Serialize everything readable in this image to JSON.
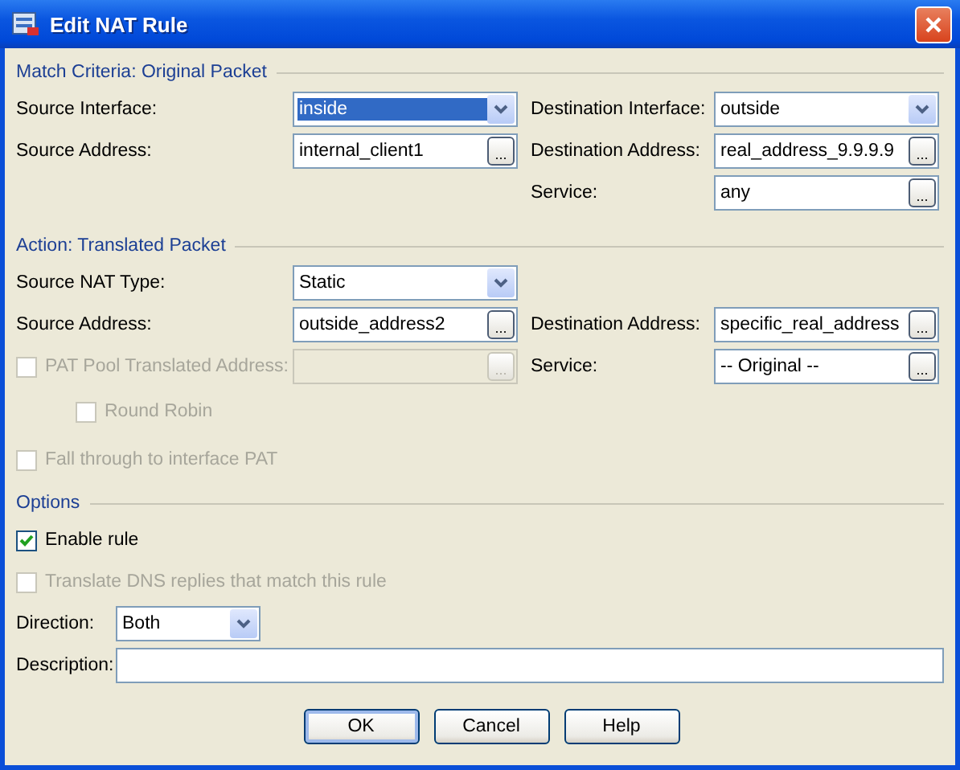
{
  "window": {
    "title": "Edit NAT Rule"
  },
  "sections": [
    {
      "title": "Match Criteria: Original Packet",
      "kind": "criteria",
      "rows": [
        {
          "items": [
            {
              "kind": "dropdown",
              "label": "Source Interface:",
              "value": "inside",
              "focused": true
            },
            {
              "kind": "dropdown",
              "label": "Destination Interface:",
              "value": "outside",
              "focused": false
            }
          ]
        },
        {
          "items": [
            {
              "kind": "browse",
              "label": "Source Address:",
              "value": "internal_client1",
              "button": "...",
              "disabled": false
            },
            {
              "kind": "browse",
              "label": "Destination Address:",
              "value": "real_address_9.9.9.9",
              "button": "...",
              "disabled": false
            }
          ]
        },
        {
          "right_items": [
            {
              "kind": "browse",
              "label": "Service:",
              "value": "any",
              "button": "...",
              "disabled": false
            }
          ]
        }
      ]
    },
    {
      "title": "Action: Translated Packet",
      "kind": "criteria",
      "rows": [
        {
          "items": [
            {
              "kind": "dropdown",
              "label": "Source NAT Type:",
              "value": "Static",
              "focused": false
            }
          ]
        },
        {
          "items": [
            {
              "kind": "browse",
              "label": "Source Address:",
              "value": "outside_address2",
              "button": "...",
              "disabled": false
            },
            {
              "kind": "browse",
              "label": "Destination Address:",
              "value": "specific_real_address",
              "button": "...",
              "disabled": false
            }
          ]
        },
        {
          "items": [
            {
              "kind": "checkbox_browse",
              "label": "PAT Pool Translated Address:",
              "button": "...",
              "checked": false,
              "disabled": true,
              "children": [
                {
                  "kind": "checkbox",
                  "label": "Round Robin",
                  "checked": false,
                  "disabled": true
                }
              ]
            },
            {
              "kind": "browse",
              "label": "Service:",
              "value": "-- Original --",
              "button": "...",
              "disabled": false
            }
          ]
        },
        {
          "items": [
            {
              "kind": "checkbox",
              "label": "Fall through to interface PAT",
              "checked": false,
              "disabled": true
            }
          ]
        }
      ]
    },
    {
      "title": "Options",
      "kind": "options",
      "rows": [
        {
          "items": [
            {
              "kind": "checkbox",
              "label": "Enable rule",
              "checked": true,
              "disabled": false
            }
          ]
        },
        {
          "items": [
            {
              "kind": "checkbox",
              "label": "Translate DNS replies that match this rule",
              "checked": false,
              "disabled": true
            }
          ]
        },
        {
          "items": [
            {
              "kind": "dropdown",
              "label": "Direction:",
              "value": "Both",
              "focused": false
            }
          ]
        },
        {
          "items": [
            {
              "kind": "text",
              "label": "Description:"
            }
          ]
        }
      ]
    }
  ],
  "buttons": [
    {
      "label": "OK",
      "focused": true
    },
    {
      "label": "Cancel",
      "focused": false
    },
    {
      "label": "Help",
      "focused": false
    }
  ]
}
